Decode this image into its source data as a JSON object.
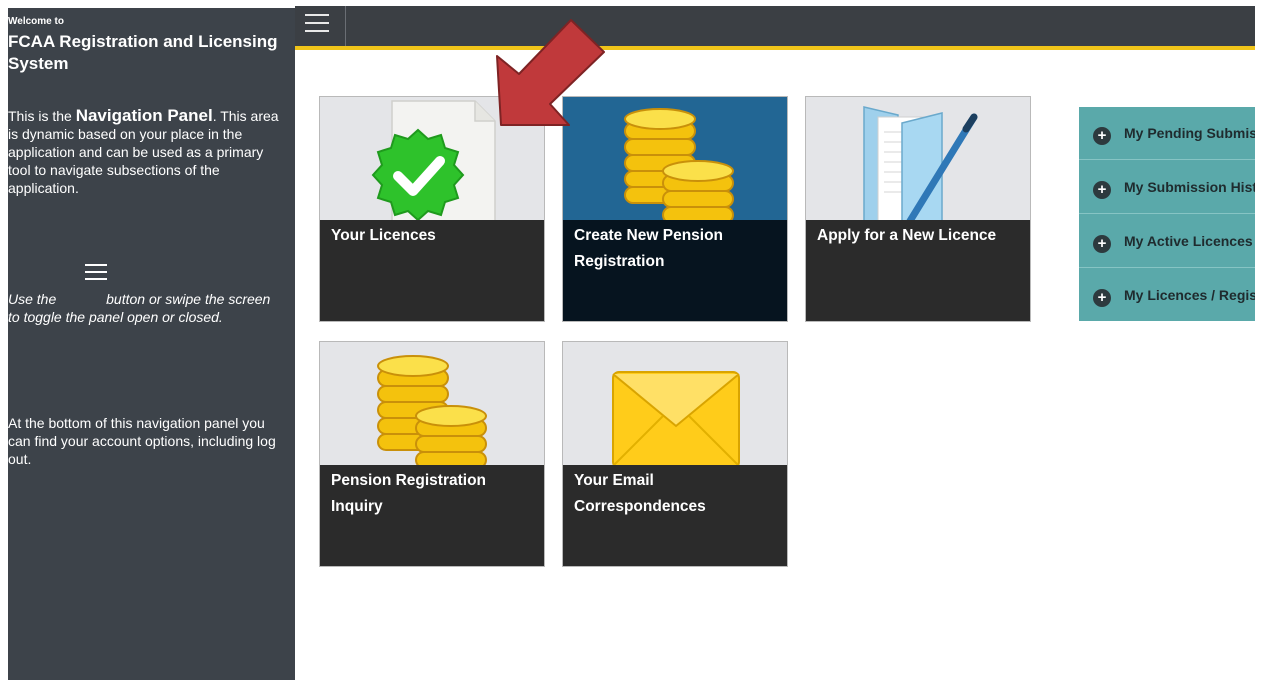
{
  "sidebar": {
    "welcome": "Welcome to",
    "system_title": "FCAA Registration and Licensing System",
    "intro_pre": "This is the ",
    "intro_bold": "Navigation Panel",
    "intro_post": ". This area is dynamic based on your place in the application and can be used as a primary tool to navigate subsections of the application.",
    "hint_pre": "Use the",
    "hint_post": "button or swipe the screen to toggle the panel open or closed.",
    "footer_text": "At the bottom of this navigation panel you can find your account options, including log out."
  },
  "tiles": [
    {
      "label": "Your Licences",
      "icon": "green-check-badge-icon"
    },
    {
      "label": "Create New Pension Registration",
      "icon": "gold-coins-icon"
    },
    {
      "label": "Apply for a New Licence",
      "icon": "folder-pen-icon"
    },
    {
      "label": "Pension Registration Inquiry",
      "icon": "gold-coins-icon"
    },
    {
      "label": "Your Email Correspondences",
      "icon": "envelope-icon"
    }
  ],
  "accordion": [
    {
      "label": "My Pending Submissions"
    },
    {
      "label": "My Submission History"
    },
    {
      "label": "My Active Licences"
    },
    {
      "label": "My Licences / Registrations"
    }
  ],
  "colors": {
    "sidebar_bg": "#3d434a",
    "topbar_bg": "#3b3f44",
    "topbar_accent": "#f0c419",
    "accordion_bg": "#5aa9aa",
    "tile_label_bg": "#2b2b2b",
    "pension_tile_bg": "#226694",
    "arrow": "#c0393b"
  }
}
